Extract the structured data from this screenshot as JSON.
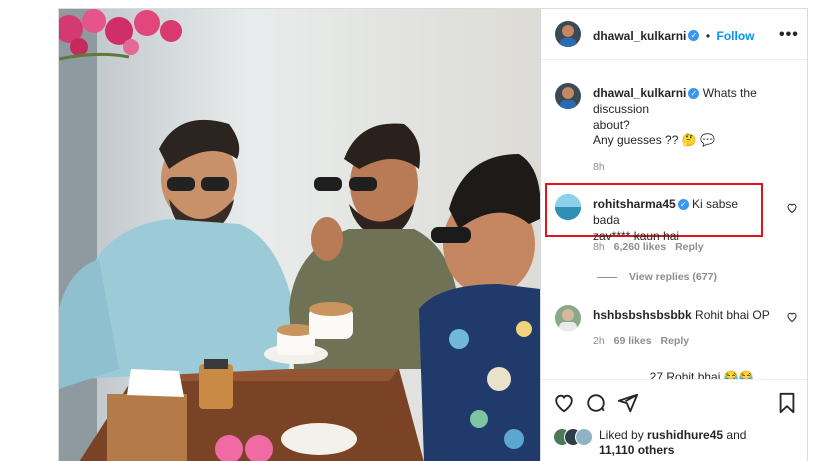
{
  "header": {
    "username": "dhawal_kulkarni",
    "separator": "•",
    "follow_label": "Follow",
    "more_icon": "more-horizontal-icon"
  },
  "caption": {
    "username": "dhawal_kulkarni",
    "text_line1": "Whats the discussion",
    "text_line2": "about?",
    "text_line3": "Any guesses ?? 🤔 💬",
    "time": "8h"
  },
  "comments": [
    {
      "username": "rohitsharma45",
      "text_line1": "Ki sabse bada",
      "text_line2": "zav**** kaun hai",
      "time": "8h",
      "likes": "6,260 likes",
      "reply_label": "Reply",
      "view_replies": "View replies (677)"
    },
    {
      "username": "hshbsbshsbsbbk",
      "text": "Rohit bhai OP",
      "time": "2h",
      "likes": "69 likes",
      "reply_label": "Reply"
    },
    {
      "partial_text": "................ 27 Rohit bhai 😂😂"
    }
  ],
  "actions": {
    "like_icon": "heart-icon",
    "comment_icon": "comment-icon",
    "share_icon": "paper-plane-icon",
    "save_icon": "bookmark-icon"
  },
  "likes_summary": {
    "prefix": "Liked by",
    "username": "rushidhure45",
    "suffix": "and",
    "others": "11,110 others"
  },
  "colors": {
    "accent_blue": "#0095f6",
    "verified_blue": "#3897f0",
    "highlight_red": "#e0141c",
    "secondary_text": "#8e8e8e"
  }
}
